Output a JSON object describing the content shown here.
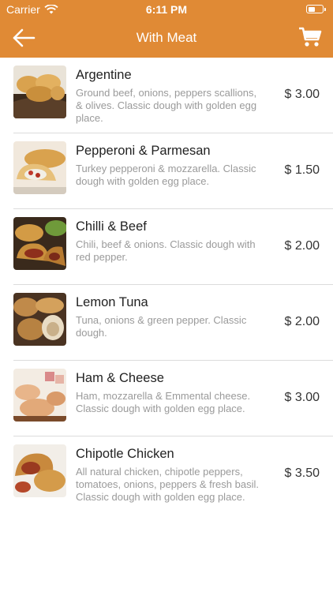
{
  "status_bar": {
    "carrier": "Carrier",
    "time": "6:11 PM"
  },
  "nav": {
    "title": "With Meat"
  },
  "items": [
    {
      "name": "Argentine",
      "description": "Ground beef, onions, peppers scallions, & olives. Classic dough with golden egg place.",
      "price": "$ 3.00"
    },
    {
      "name": "Pepperoni & Parmesan",
      "description": "Turkey pepperoni & mozzarella. Classic dough with golden egg place.",
      "price": "$ 1.50"
    },
    {
      "name": "Chilli & Beef",
      "description": "Chili, beef & onions. Classic dough with red pepper.",
      "price": "$ 2.00"
    },
    {
      "name": "Lemon Tuna",
      "description": "Tuna, onions & green pepper. Classic dough.",
      "price": "$ 2.00"
    },
    {
      "name": "Ham & Cheese",
      "description": "Ham, mozzarella & Emmental cheese. Classic dough with golden egg place.",
      "price": "$ 3.00"
    },
    {
      "name": "Chipotle Chicken",
      "description": "All natural chicken, chipotle peppers, tomatoes, onions, peppers & fresh basil. Classic dough with golden egg place.",
      "price": "$ 3.50"
    }
  ],
  "colors": {
    "header": "#E08A35",
    "text": "#222222",
    "description": "#9A9A9A",
    "divider": "#DCDCDC"
  },
  "icons": [
    "back-arrow-icon",
    "cart-icon",
    "wifi-icon",
    "battery-icon"
  ]
}
